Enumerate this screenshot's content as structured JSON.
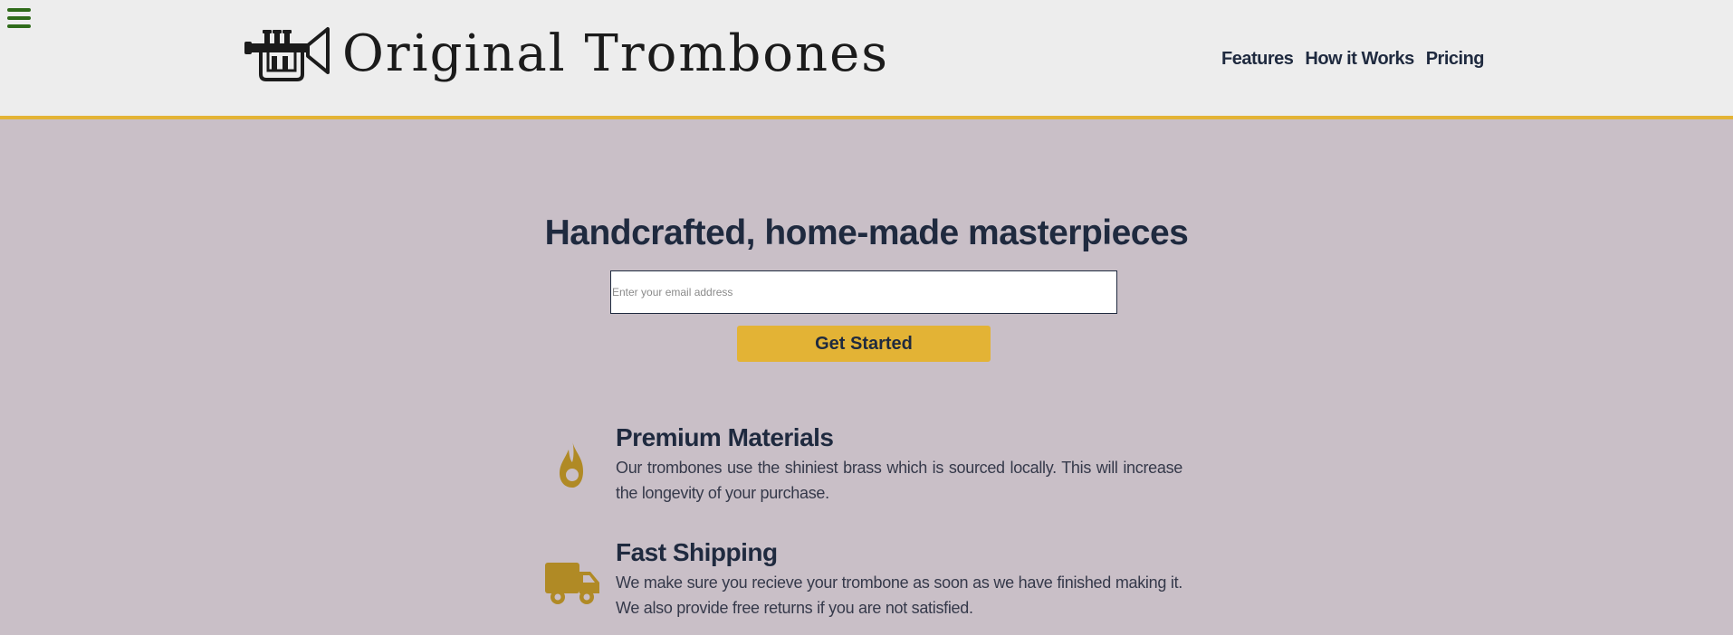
{
  "header": {
    "brand": "Original Trombones",
    "nav": [
      {
        "label": "Features"
      },
      {
        "label": "How it Works"
      },
      {
        "label": "Pricing"
      }
    ]
  },
  "hero": {
    "title": "Handcrafted, home-made masterpieces",
    "email_placeholder": "Enter your email address",
    "cta_label": "Get Started"
  },
  "features": [
    {
      "icon": "fire-icon",
      "title": "Premium Materials",
      "text": "Our trombones use the shiniest brass which is sourced locally. This will increase the longevity of your purchase."
    },
    {
      "icon": "truck-icon",
      "title": "Fast Shipping",
      "text": "We make sure you recieve your trombone as soon as we have finished making it. We also provide free returns if you are not satisfied."
    }
  ],
  "colors": {
    "background": "#c9bfc7",
    "header": "#ededed",
    "accent": "#e3b335",
    "icon": "#b08a25",
    "text": "#1f2a3f",
    "menu": "#2f6b1a"
  }
}
